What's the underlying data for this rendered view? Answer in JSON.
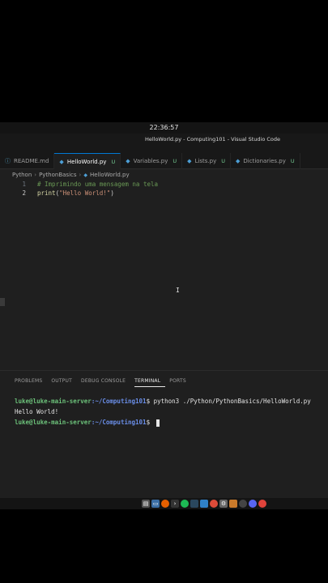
{
  "clock": "22:36:57",
  "window_title": "HelloWorld.py - Computing101 - Visual Studio Code",
  "tabs": [
    {
      "label": "README.md",
      "icon": "info-icon",
      "badge": ""
    },
    {
      "label": "HelloWorld.py",
      "icon": "python-icon",
      "badge": "U"
    },
    {
      "label": "Variables.py",
      "icon": "python-icon",
      "badge": "U"
    },
    {
      "label": "Lists.py",
      "icon": "python-icon",
      "badge": "U"
    },
    {
      "label": "Dictionaries.py",
      "icon": "python-icon",
      "badge": "U"
    }
  ],
  "breadcrumb": {
    "root": "Python",
    "folder": "PythonBasics",
    "file": "HelloWorld.py"
  },
  "editor": {
    "lines": [
      {
        "num": "1",
        "comment": "# Imprimindo uma mensagem na tela"
      },
      {
        "num": "2",
        "fn": "print",
        "open": "(",
        "str": "\"Hello World!\"",
        "close": ")"
      }
    ]
  },
  "panel_tabs": [
    "PROBLEMS",
    "OUTPUT",
    "DEBUG CONSOLE",
    "TERMINAL",
    "PORTS"
  ],
  "terminal": {
    "user": "luke@luke-main-server",
    "path": ":~/Computing101",
    "prompt": "$ ",
    "command": "python3 ./Python/PythonBasics/HelloWorld.py",
    "output": "Hello World!"
  },
  "taskbar_icons": [
    "files-icon",
    "window-icon",
    "firefox-icon",
    "terminal-icon",
    "spotify-icon",
    "steam-icon",
    "document-icon",
    "chrome-icon",
    "settings-icon",
    "game-icon",
    "gpu-icon",
    "discord-icon",
    "browser-icon"
  ],
  "colors": {
    "accent": "#0078d4",
    "terminal_user": "#6cc17a",
    "terminal_path": "#6a8ee8",
    "untracked": "#73c991"
  }
}
